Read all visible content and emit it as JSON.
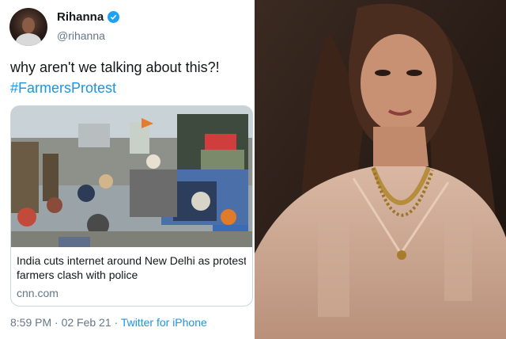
{
  "tweet": {
    "display_name": "Rihanna",
    "handle": "@rihanna",
    "text": "why aren't we talking about this?!",
    "hashtag": "#FarmersProtest",
    "card": {
      "title_line1": "India cuts internet around New Delhi as protesti",
      "title_line2": "farmers clash with police",
      "domain": "cnn.com"
    },
    "timestamp": "8:59 PM · 02 Feb 21",
    "separator": " · ",
    "source": "Twitter for iPhone"
  },
  "colors": {
    "link": "#1b95e0",
    "verified_badge": "#1da1f2",
    "secondary_text": "#657786"
  },
  "icons": [
    "verified-badge-icon"
  ]
}
